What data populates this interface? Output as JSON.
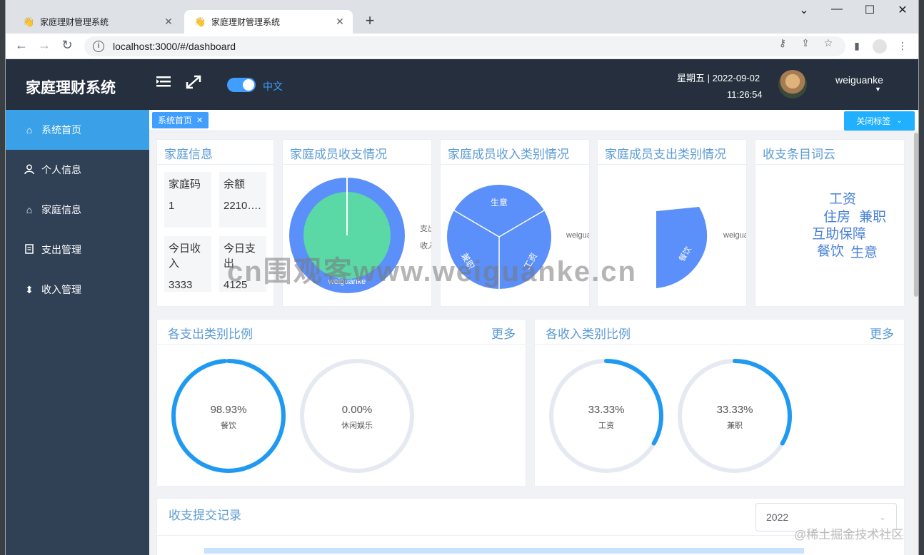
{
  "browser": {
    "tabs": [
      {
        "title": "家庭理财管理系统",
        "active": false
      },
      {
        "title": "家庭理财管理系统",
        "active": true
      }
    ],
    "url": "localhost:3000/#/dashboard"
  },
  "header": {
    "logo": "家庭理财系统",
    "lang": "中文",
    "weekday_date": "星期五 | 2022-09-02",
    "time": "11:26:54",
    "username": "weiguanke"
  },
  "sidebar": {
    "items": [
      {
        "label": "系统首页",
        "icon": "home-icon"
      },
      {
        "label": "个人信息",
        "icon": "user-icon"
      },
      {
        "label": "家庭信息",
        "icon": "house-icon"
      },
      {
        "label": "支出管理",
        "icon": "document-icon"
      },
      {
        "label": "收入管理",
        "icon": "sort-icon"
      }
    ]
  },
  "tags": {
    "current": "系统首页",
    "close_all": "关闭标签"
  },
  "cards": {
    "family_info": {
      "title": "家庭信息",
      "cells": [
        {
          "label": "家庭码",
          "value": "1"
        },
        {
          "label": "余额",
          "value": "2210…."
        },
        {
          "label": "今日收入",
          "value": "3333"
        },
        {
          "label": "今日支出",
          "value": "4125"
        }
      ]
    },
    "member_io": {
      "title": "家庭成员收支情况",
      "center_label": "weiguanke",
      "legend": [
        "支出",
        "收入"
      ]
    },
    "member_income": {
      "title": "家庭成员收入类别情况",
      "slices": [
        "生意",
        "兼职",
        "工资"
      ],
      "legend": "weiguanke"
    },
    "member_expense": {
      "title": "家庭成员支出类别情况",
      "slice_label": "餐饮",
      "legend": "weiguanke"
    },
    "wordcloud": {
      "title": "收支条目词云",
      "words": [
        "工资",
        "住房",
        "兼职",
        "互助保障",
        "餐饮",
        "生意"
      ]
    },
    "expense_ratio": {
      "title": "各支出类别比例",
      "more": "更多",
      "rings": [
        {
          "pct": "98.93%",
          "label": "餐饮",
          "value": 0.9893
        },
        {
          "pct": "0.00%",
          "label": "休闲娱乐",
          "value": 0
        }
      ]
    },
    "income_ratio": {
      "title": "各收入类别比例",
      "more": "更多",
      "rings": [
        {
          "pct": "33.33%",
          "label": "工资",
          "value": 0.3333
        },
        {
          "pct": "33.33%",
          "label": "兼职",
          "value": 0.3333
        }
      ]
    },
    "records": {
      "title": "收支提交记录",
      "year": "2022"
    }
  },
  "colors": {
    "header_bg": "#252f3d",
    "sidebar_bg": "#304156",
    "active_menu": "#3aa1e8",
    "accent": "#409eff",
    "ring": "#1e9af2",
    "pie_blue": "#5b8ff9",
    "pie_green": "#5ad8a6"
  },
  "watermark": "cn围观客www.weiguanke.cn",
  "footer_mark": "@稀土掘金技术社区"
}
